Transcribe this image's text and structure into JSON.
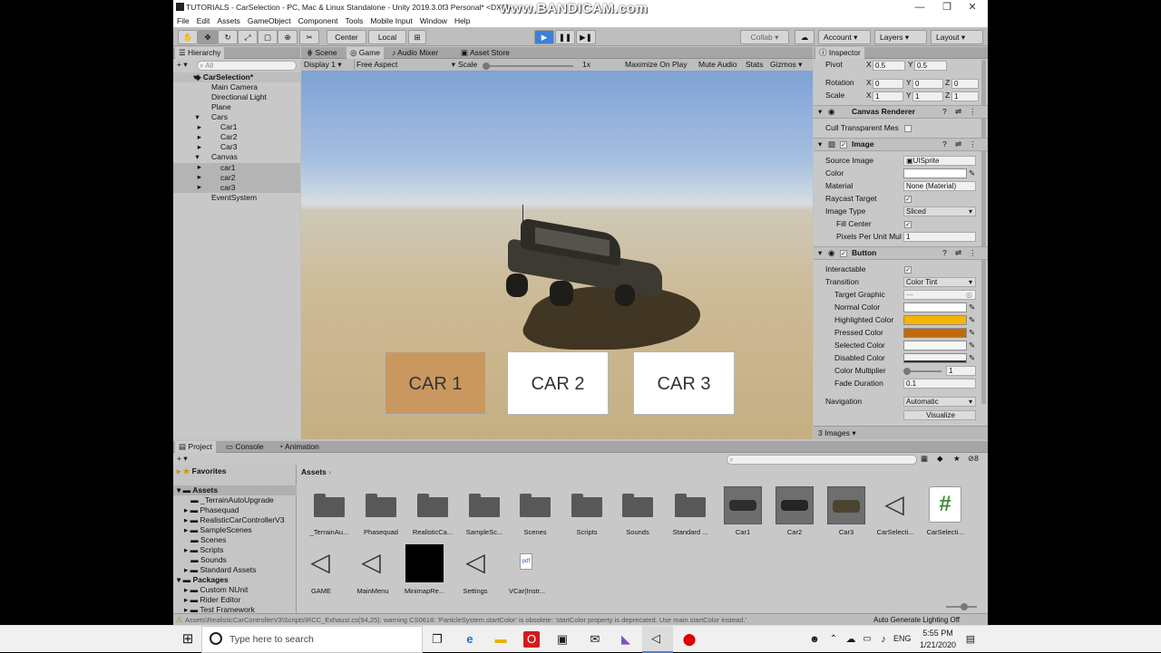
{
  "window": {
    "title": "TUTORIALS - CarSelection - PC, Mac & Linux Standalone - Unity 2019.3.0f3 Personal* <DX11>",
    "watermark": "www.BANDICAM.com",
    "controls": {
      "minimize": "—",
      "maximize": "❐",
      "close": "✕"
    }
  },
  "menu": [
    "File",
    "Edit",
    "Assets",
    "GameObject",
    "Component",
    "Tools",
    "Mobile Input",
    "Window",
    "Help"
  ],
  "toolbar": {
    "center": "Center",
    "local": "Local",
    "collab": "Collab ▾",
    "account": "Account",
    "layers": "Layers",
    "layout": "Layout"
  },
  "hierarchy": {
    "tab": "Hierarchy",
    "search_placeholder": "All",
    "scene": "CarSelection*",
    "items": [
      "Main Camera",
      "Directional Light",
      "Plane",
      "Cars",
      "Car1",
      "Car2",
      "Car3",
      "Canvas",
      "car1",
      "car2",
      "car3",
      "EventSystem"
    ]
  },
  "game": {
    "tabs": [
      "Scene",
      "Game",
      "Audio Mixer",
      "Asset Store"
    ],
    "display": "Display 1",
    "aspect": "Free Aspect",
    "scale_label": "Scale",
    "scale_value": "1x",
    "options": [
      "Maximize On Play",
      "Mute Audio",
      "Stats",
      "Gizmos"
    ],
    "buttons": [
      "CAR 1",
      "CAR 2",
      "CAR 3"
    ]
  },
  "inspector": {
    "tab": "Inspector",
    "pivot": {
      "label": "Pivot",
      "x": "0.5",
      "y": "0.5"
    },
    "rotation": {
      "label": "Rotation",
      "x": "0",
      "y": "0",
      "z": "0"
    },
    "scale": {
      "label": "Scale",
      "x": "1",
      "y": "1",
      "z": "1"
    },
    "canvas_renderer": {
      "title": "Canvas Renderer",
      "cull": "Cull Transparent Mes"
    },
    "image": {
      "title": "Image",
      "source_label": "Source Image",
      "source_value": "UISprite",
      "color_label": "Color",
      "material_label": "Material",
      "material_value": "None (Material)",
      "raycast_label": "Raycast Target",
      "type_label": "Image Type",
      "type_value": "Sliced",
      "fill_label": "Fill Center",
      "ppu_label": "Pixels Per Unit Mul",
      "ppu_value": "1"
    },
    "button": {
      "title": "Button",
      "interactable_label": "Interactable",
      "transition_label": "Transition",
      "transition_value": "Color Tint",
      "target_label": "Target Graphic",
      "normal_label": "Normal Color",
      "highlighted_label": "Highlighted Color",
      "pressed_label": "Pressed Color",
      "selected_label": "Selected Color",
      "disabled_label": "Disabled Color",
      "multiplier_label": "Color Multiplier",
      "multiplier_value": "1",
      "fade_label": "Fade Duration",
      "fade_value": "0.1",
      "navigation_label": "Navigation",
      "navigation_value": "Automatic",
      "visualize": "Visualize"
    },
    "footer": "3 Images"
  },
  "colors": {
    "normal": "#ffffff",
    "highlighted": "#f5b400",
    "pressed": "#c06a0a",
    "selected": "#f5f5f5",
    "car1_button": "#c9985f"
  },
  "project": {
    "tabs": [
      "Project",
      "Console",
      "Animation"
    ],
    "favorites": "Favorites",
    "assets_root": "Assets",
    "tree": [
      "_TerrainAutoUpgrade",
      "Phasequad",
      "RealisticCarControllerV3",
      "SampleScenes",
      "Scenes",
      "Scripts",
      "Sounds",
      "Standard Assets"
    ],
    "packages": "Packages",
    "packages_tree": [
      "Custom NUnit",
      "Rider Editor",
      "Test Framework"
    ],
    "breadcrumb": "Assets",
    "badge": "8",
    "assets_row1": [
      "_TerrainAu...",
      "Phasequad",
      "RealisticCa...",
      "SampleSc...",
      "Scenes",
      "Scripts",
      "Sounds",
      "Standard ...",
      "Car1",
      "Car2",
      "Car3",
      "CarSelecti...",
      "CarSelecti..."
    ],
    "assets_row2": [
      "GAME",
      "MainMenu",
      "MinimapRe...",
      "Settings",
      "VCar(Instr..."
    ]
  },
  "status": {
    "warning": "Assets\\RealisticCarControllerV3\\Scripts\\RCC_Exhaust.cs(94,25): warning CS0618: 'ParticleSystem.startColor' is obsolete: 'startColor property is deprecated. Use main.startColor instead.'",
    "right": "Auto Generate Lighting Off"
  },
  "taskbar": {
    "search": "Type here to search",
    "lang": "ENG",
    "time": "5:55 PM",
    "date": "1/21/2020"
  }
}
